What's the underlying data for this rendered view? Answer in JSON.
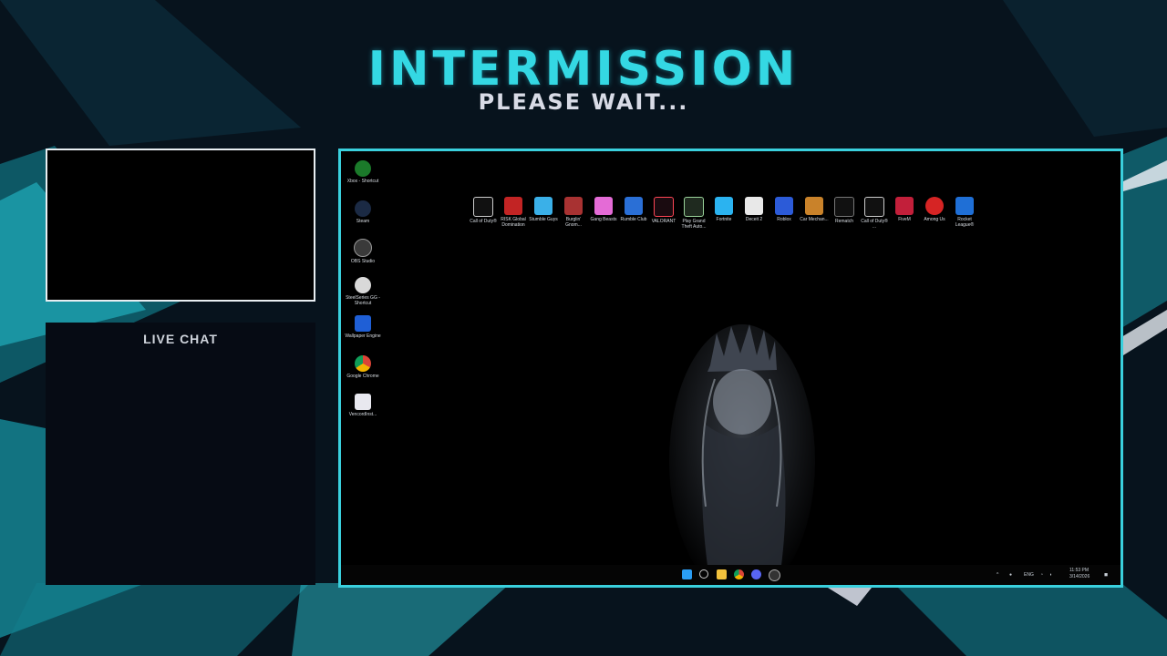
{
  "overlay": {
    "title": "INTERMISSION",
    "subtitle": "PLEASE WAIT...",
    "chat_label": "LIVE CHAT",
    "accent_color": "#34d8e3"
  },
  "desktop": {
    "left_icons": [
      {
        "label": "Xbox - Shortcut",
        "icon": "xbox-icon"
      },
      {
        "label": "Steam",
        "icon": "steam-icon"
      },
      {
        "label": "OBS Studio",
        "icon": "obs-icon"
      },
      {
        "label": "SteelSeries GG - Shortcut",
        "icon": "steelseries-icon"
      },
      {
        "label": "Wallpaper Engine",
        "icon": "wallpaper-engine-icon"
      },
      {
        "label": "Google Chrome",
        "icon": "chrome-icon"
      },
      {
        "label": "VencordInst...",
        "icon": "vencord-icon"
      }
    ],
    "game_icons": [
      {
        "label": "Call of Duty®",
        "icon": "call-of-duty-icon"
      },
      {
        "label": "RISK Global Domination",
        "icon": "risk-icon"
      },
      {
        "label": "Stumble Guys",
        "icon": "stumble-guys-icon"
      },
      {
        "label": "Burglin' Gnom...",
        "icon": "burglin-gnomes-icon"
      },
      {
        "label": "Gang Beasts",
        "icon": "gang-beasts-icon"
      },
      {
        "label": "Rumble Club",
        "icon": "rumble-club-icon"
      },
      {
        "label": "VALORANT",
        "icon": "valorant-icon"
      },
      {
        "label": "Play Grand Theft Auto...",
        "icon": "gta-icon"
      },
      {
        "label": "Fortnite",
        "icon": "fortnite-icon"
      },
      {
        "label": "Deceit 2",
        "icon": "deceit-icon"
      },
      {
        "label": "Roblox",
        "icon": "roblox-icon"
      },
      {
        "label": "Car Mechan...",
        "icon": "car-mechanic-icon"
      },
      {
        "label": "Rematch",
        "icon": "rematch-icon"
      },
      {
        "label": "Call of Duty® ...",
        "icon": "call-of-duty-icon"
      },
      {
        "label": "FiveM",
        "icon": "fivem-icon"
      },
      {
        "label": "Among Us",
        "icon": "among-us-icon"
      },
      {
        "label": "Rocket League®",
        "icon": "rocket-league-icon"
      }
    ],
    "taskbar": {
      "apps": [
        "windows-start-icon",
        "search-icon",
        "file-explorer-icon",
        "chrome-icon",
        "discord-icon",
        "obs-icon"
      ],
      "language": "ENG",
      "time": "11:53 PM",
      "date": "3/14/2026"
    }
  }
}
